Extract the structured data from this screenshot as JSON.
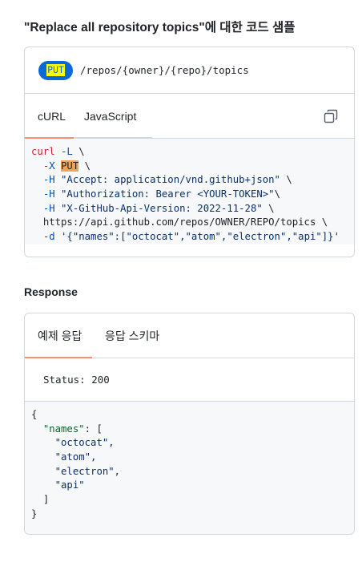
{
  "title": "\"Replace all repository topics\"에 대한 코드 샘플",
  "endpoint": {
    "method": "PUT",
    "path": "/repos/{owner}/{repo}/topics"
  },
  "code_tabs": [
    "cURL",
    "JavaScript"
  ],
  "copy_icon": "copy-icon",
  "curl": {
    "cmd": "curl",
    "flag_L": "-L",
    "flag_X": "-X",
    "method": "PUT",
    "flag_H": "-H",
    "header_accept": "\"Accept: application/vnd.github+json\"",
    "header_auth": "\"Authorization: Bearer <YOUR-TOKEN>\"",
    "header_version": "\"X-GitHub-Api-Version: 2022-11-28\"",
    "url": "https://api.github.com/repos/OWNER/REPO/topics",
    "flag_d": "-d",
    "body": "'{\"names\":[\"octocat\",\"atom\",\"electron\",\"api\"]}'",
    "cont": "\\"
  },
  "response": {
    "heading": "Response",
    "tabs": [
      "예제 응답",
      "응답 스키마"
    ],
    "status": "Status: 200",
    "json": {
      "open": "{",
      "key": "\"names\"",
      "colon_bracket": ": [",
      "items": [
        "\"octocat\",",
        "\"atom\",",
        "\"electron\",",
        "\"api\""
      ],
      "close_bracket": "]",
      "close": "}"
    }
  },
  "colors": {
    "accent_blue": "#0969da",
    "highlight_yellow": "#ffff00",
    "tab_active": "#fd8c73",
    "border": "#d0d7de",
    "code_bg": "#f6f8fa"
  }
}
